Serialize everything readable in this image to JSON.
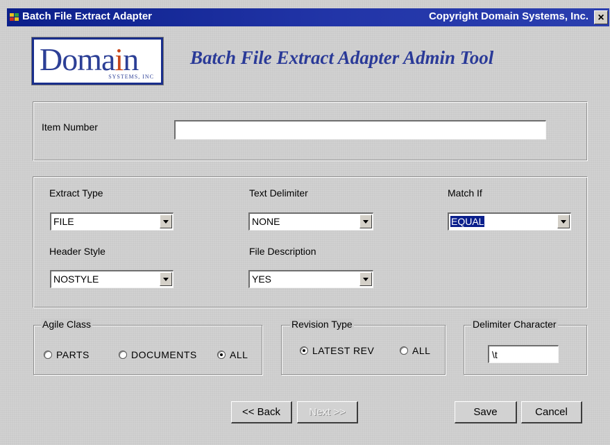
{
  "window": {
    "title": "Batch File Extract Adapter",
    "copyright": "Copyright Domain Systems, Inc.",
    "close_label": "×"
  },
  "logo": {
    "word": "Doma",
    "word_i": "i",
    "word_end": "n",
    "sub": "SYSTEMS, INC"
  },
  "heading": "Batch File Extract Adapter Admin Tool",
  "item_number": {
    "label": "Item Number",
    "value": ""
  },
  "extract_type": {
    "label": "Extract Type",
    "value": "FILE"
  },
  "text_delimiter": {
    "label": "Text Delimiter",
    "value": "NONE"
  },
  "match_if": {
    "label": "Match If",
    "value": "EQUAL"
  },
  "header_style": {
    "label": "Header Style",
    "value": "NOSTYLE"
  },
  "file_description": {
    "label": "File Description",
    "value": "YES"
  },
  "agile_class": {
    "legend": "Agile Class",
    "options": [
      "PARTS",
      "DOCUMENTS",
      "ALL"
    ],
    "selected": "ALL"
  },
  "revision_type": {
    "legend": "Revision Type",
    "options": [
      "LATEST REV",
      "ALL"
    ],
    "selected": "LATEST REV"
  },
  "delimiter_character": {
    "legend": "Delimiter Character",
    "value": "\\t"
  },
  "buttons": {
    "back": "<< Back",
    "next": "Next >>",
    "save": "Save",
    "cancel": "Cancel"
  },
  "colors": {
    "titlebar": "#0b1f8a",
    "heading": "#2a3a98",
    "selection": "#0a1f8c"
  }
}
